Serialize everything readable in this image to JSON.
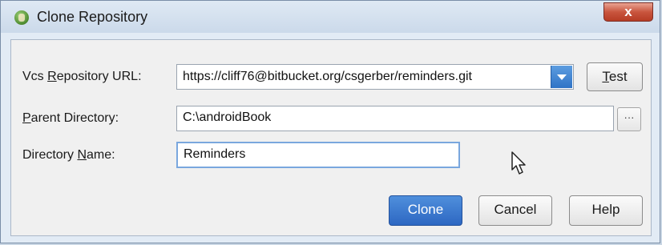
{
  "window": {
    "title": "Clone Repository",
    "close_glyph": "x"
  },
  "form": {
    "vcs_url": {
      "label_pre": "Vcs ",
      "label_mnemonic": "R",
      "label_post": "epository URL:",
      "value": "https://cliff76@bitbucket.org/csgerber/reminders.git"
    },
    "parent_dir": {
      "label_mnemonic": "P",
      "label_post": "arent Directory:",
      "value": "C:\\androidBook"
    },
    "dir_name": {
      "label_pre": "Directory ",
      "label_mnemonic": "N",
      "label_post": "ame:",
      "value": "Reminders"
    }
  },
  "buttons": {
    "test": {
      "mnemonic": "T",
      "rest": "est"
    },
    "browse": "···",
    "clone": "Clone",
    "cancel": "Cancel",
    "help": "Help"
  },
  "colors": {
    "primary": "#2d67c2",
    "close": "#c9553e",
    "focus": "#7aa7de"
  }
}
